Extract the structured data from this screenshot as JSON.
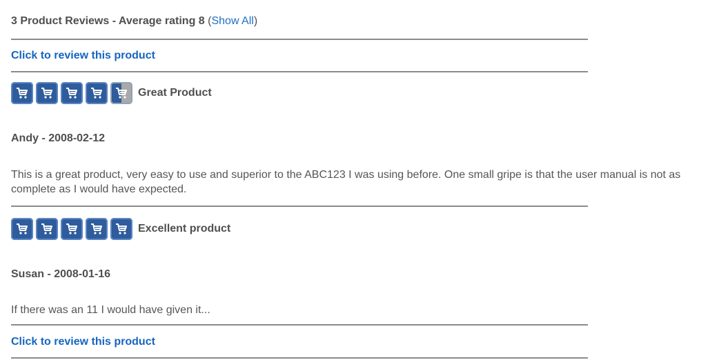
{
  "summary": {
    "text": "3 Product Reviews - Average rating 8",
    "open_paren": " (",
    "show_all_label": "Show All",
    "close_paren": ")"
  },
  "review_link_top": "Click to review this product",
  "reviews": [
    {
      "rating_fraction": 0.9,
      "title": "Great Product",
      "author_date": "Andy - 2008-02-12",
      "body": "This is a great product, very easy to use and superior to the ABC123 I was using before. One small gripe is that the user manual is not as complete as I would have expected."
    },
    {
      "rating_fraction": 1.0,
      "title": "Excellent product",
      "author_date": "Susan - 2008-01-16",
      "body": "If there was an 11 I would have given it..."
    }
  ],
  "review_link_bottom": "Click to review this product",
  "icon": "shopping-cart-icon",
  "colors": {
    "link": "#1565c0",
    "star": "#2e5c9c",
    "rule": "#8a8a8a"
  }
}
